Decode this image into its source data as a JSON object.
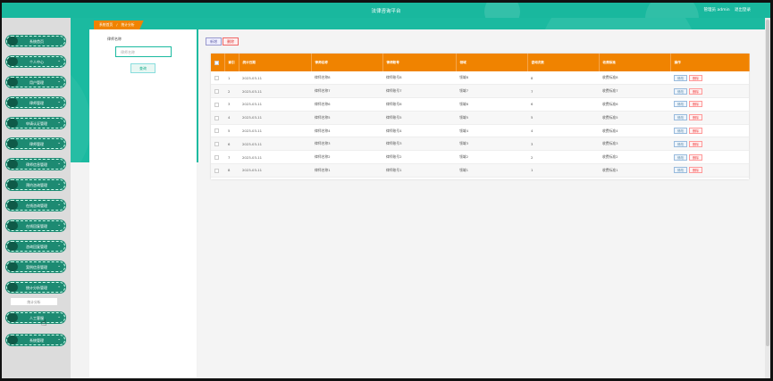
{
  "header": {
    "title": "法律咨询平台",
    "user_text": "管理员 admin",
    "logout": "退出登录"
  },
  "sidebar": {
    "items": [
      {
        "label": "系统首页",
        "chevron": false
      },
      {
        "label": "个人中心",
        "chevron": true
      },
      {
        "label": "用户管理",
        "chevron": true
      },
      {
        "label": "律师管理",
        "chevron": true
      },
      {
        "label": "申请认证管理",
        "chevron": true
      },
      {
        "label": "律师管理",
        "chevron": true
      },
      {
        "label": "律师信息管理",
        "chevron": true
      },
      {
        "label": "预约咨询管理",
        "chevron": true
      },
      {
        "label": "在线咨询管理",
        "chevron": true
      },
      {
        "label": "在线回复管理",
        "chevron": true
      },
      {
        "label": "咨询回复管理",
        "chevron": true
      },
      {
        "label": "案例信息管理",
        "chevron": true
      },
      {
        "label": "统计分析管理",
        "chevron": true
      },
      {
        "label": "人工客服",
        "chevron": true
      },
      {
        "label": "系统管理",
        "chevron": true
      }
    ],
    "sub_item": "统计分析"
  },
  "breadcrumb": {
    "home": "系统首页",
    "sep": "/",
    "current": "统计分析"
  },
  "filter": {
    "label": "律师名称",
    "placeholder": "律师名称",
    "search_button": "查询"
  },
  "toolbar": {
    "add": "新增",
    "delete": "删除"
  },
  "table": {
    "headers": [
      "",
      "索引",
      "统计日期",
      "律师名称",
      "律师账号",
      "领域",
      "咨询次数",
      "收费标准",
      "操作"
    ],
    "rows": [
      {
        "index": "1",
        "date": "2023-03-11",
        "name": "律师名称8",
        "account": "律师账号8",
        "field": "领域8",
        "count": "8",
        "fee": "收费标准8"
      },
      {
        "index": "2",
        "date": "2023-03-11",
        "name": "律师名称7",
        "account": "律师账号7",
        "field": "领域7",
        "count": "7",
        "fee": "收费标准7"
      },
      {
        "index": "3",
        "date": "2023-03-11",
        "name": "律师名称6",
        "account": "律师账号6",
        "field": "领域6",
        "count": "6",
        "fee": "收费标准6"
      },
      {
        "index": "4",
        "date": "2023-03-11",
        "name": "律师名称5",
        "account": "律师账号5",
        "field": "领域5",
        "count": "5",
        "fee": "收费标准5"
      },
      {
        "index": "5",
        "date": "2023-03-11",
        "name": "律师名称4",
        "account": "律师账号4",
        "field": "领域4",
        "count": "4",
        "fee": "收费标准4"
      },
      {
        "index": "6",
        "date": "2023-03-11",
        "name": "律师名称3",
        "account": "律师账号3",
        "field": "领域3",
        "count": "3",
        "fee": "收费标准3"
      },
      {
        "index": "7",
        "date": "2023-03-11",
        "name": "律师名称2",
        "account": "律师账号2",
        "field": "领域2",
        "count": "2",
        "fee": "收费标准2"
      },
      {
        "index": "8",
        "date": "2023-03-11",
        "name": "律师名称1",
        "account": "律师账号1",
        "field": "领域1",
        "count": "1",
        "fee": "收费标准1"
      }
    ],
    "edit_label": "修改",
    "delete_label": "删除"
  },
  "colors": {
    "teal": "#19b89e",
    "orange": "#f08300",
    "sidebar_item": "#1d8a72"
  },
  "icons": {
    "chevron": "chevron-down-icon",
    "cursor": "hand-pointer-icon"
  }
}
